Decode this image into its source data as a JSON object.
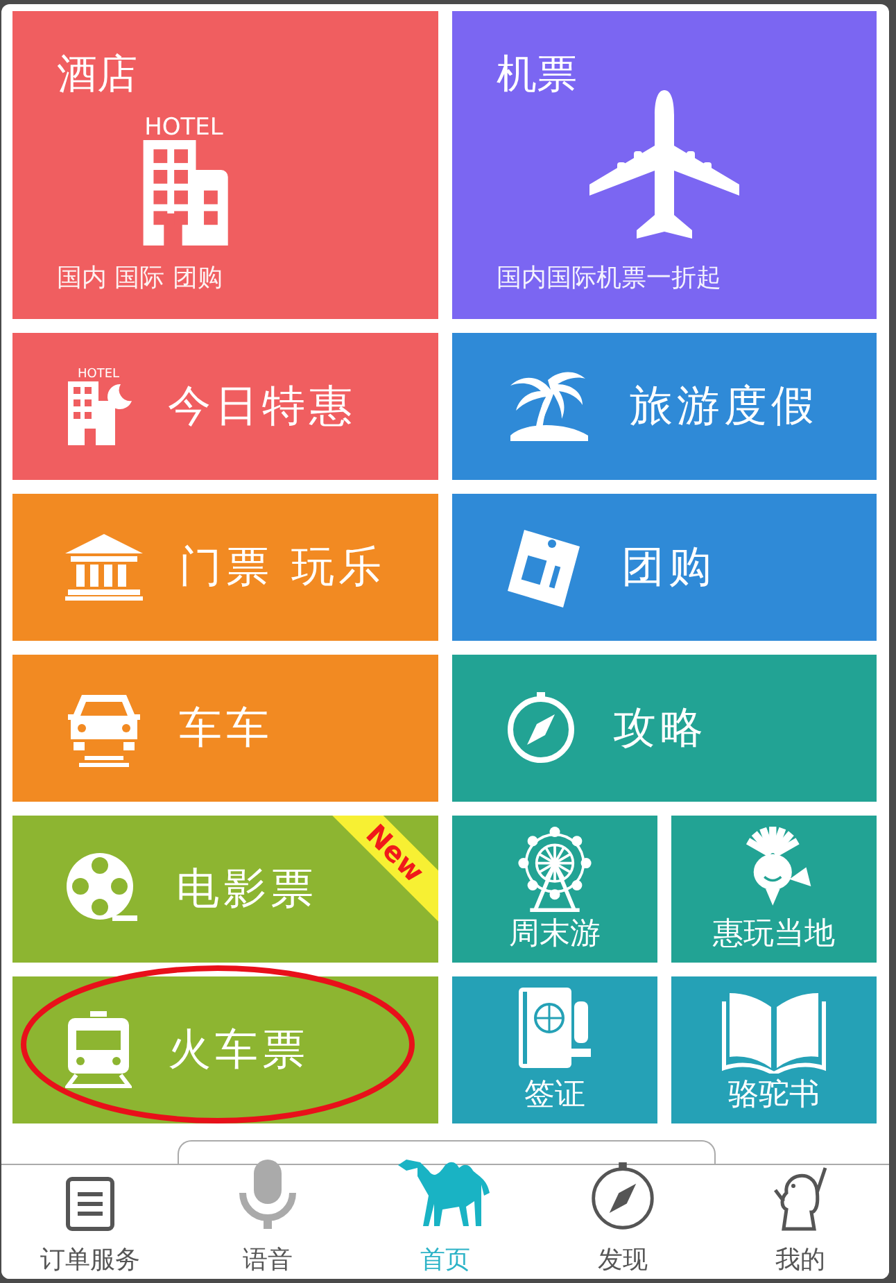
{
  "tiles": [
    {
      "kind": "large",
      "title": "酒店",
      "subtitle": "国内 国际 团购",
      "icon_label": "HOTEL",
      "color": "#f05e60"
    },
    {
      "kind": "large",
      "title": "机票",
      "subtitle": "国内国际机票一折起",
      "color": "#7b66f2"
    },
    {
      "kind": "wide",
      "title": "今日特惠",
      "icon_label": "HOTEL",
      "color": "#f05e60"
    },
    {
      "kind": "wide",
      "title": "旅游度假",
      "color": "#2f8ad7"
    },
    {
      "kind": "wide",
      "title": "门票 玩乐",
      "color": "#f28a22"
    },
    {
      "kind": "wide",
      "title": "团购",
      "color": "#2f8ad7"
    },
    {
      "kind": "wide",
      "title": "车车",
      "color": "#f28a22"
    },
    {
      "kind": "wide",
      "title": "攻略",
      "color": "#22a394"
    },
    {
      "kind": "wide",
      "title": "电影票",
      "badge": "New",
      "color": "#8db531"
    },
    {
      "kind": "small",
      "title": "周末游",
      "color": "#22a394"
    },
    {
      "kind": "small",
      "title": "惠玩当地",
      "color": "#22a394"
    },
    {
      "kind": "wide",
      "title": "火车票",
      "circled": true,
      "color": "#8db531"
    },
    {
      "kind": "small",
      "title": "签证",
      "color": "#25a1b6"
    },
    {
      "kind": "small",
      "title": "骆驼书",
      "color": "#25a1b6"
    }
  ],
  "tab_bar": [
    {
      "label": "订单服务",
      "selected": false
    },
    {
      "label": "语音",
      "selected": false
    },
    {
      "label": "首页",
      "selected": true
    },
    {
      "label": "发现",
      "selected": false
    },
    {
      "label": "我的",
      "selected": false
    }
  ]
}
